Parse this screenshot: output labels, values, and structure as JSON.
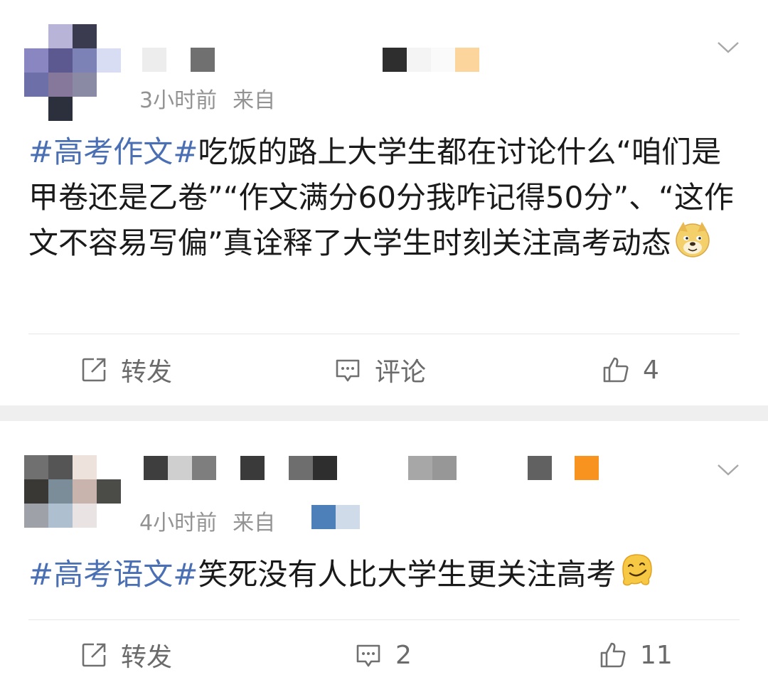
{
  "colors": {
    "topic": "#4a6fb3",
    "meta": "#939393",
    "action": "#6b6b6b",
    "separator": "#efefef"
  },
  "posts": [
    {
      "time": "3小时前",
      "source_prefix": "来自",
      "topic": "#高考作文#",
      "body": "吃饭的路上大学生都在讨论什么“咱们是甲卷还是乙卷”“作文满分60分我咋记得50分”、“这作文不容易写偏”真诠释了大学生时刻关注高考动态",
      "emoji": "doge-emoji",
      "actions": {
        "repost": "转发",
        "comment": "评论",
        "like": "4"
      }
    },
    {
      "time": "4小时前",
      "source_prefix": "来自",
      "topic": "#高考语文#",
      "body": "笑死没有人比大学生更关注高考",
      "emoji": "melting-face-emoji",
      "actions": {
        "repost": "转发",
        "comment": "2",
        "like": "11"
      }
    }
  ]
}
